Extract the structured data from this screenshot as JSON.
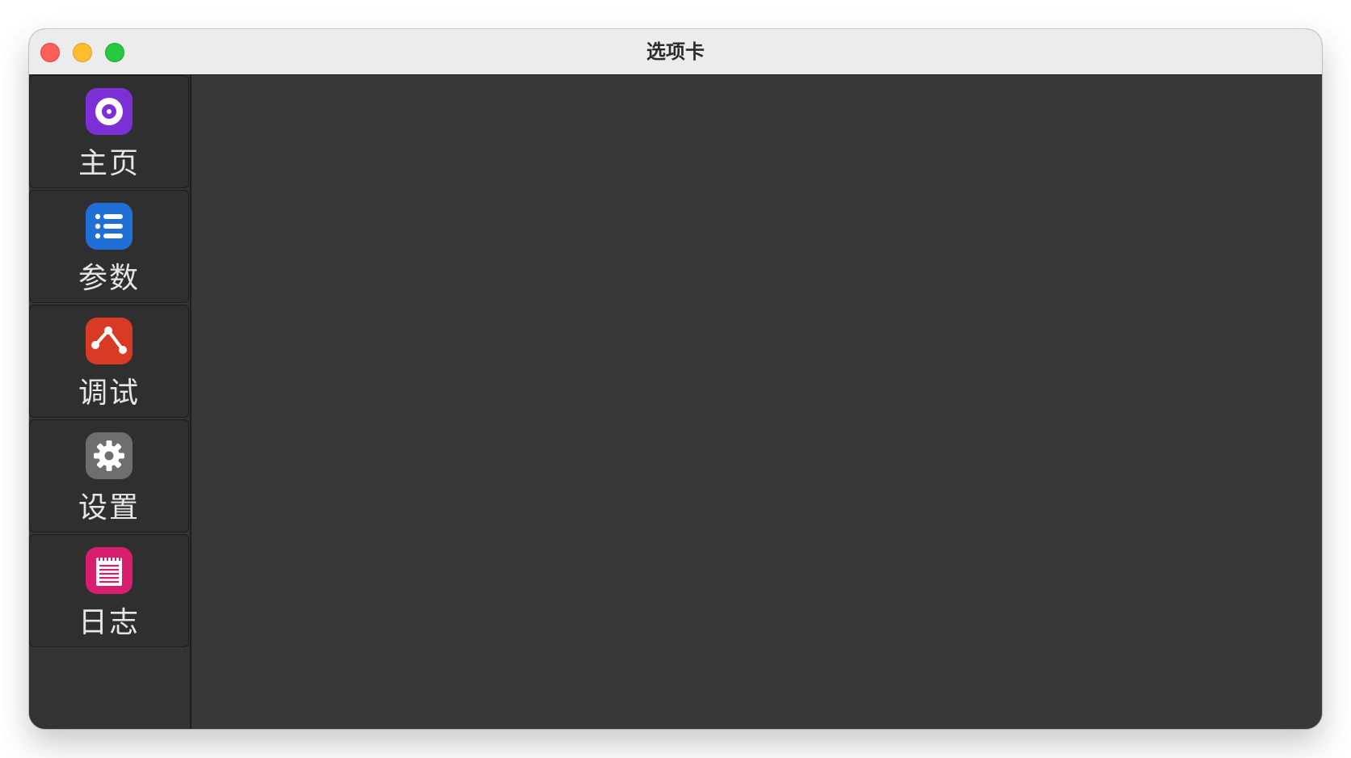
{
  "window": {
    "title": "选项卡"
  },
  "sidebar": {
    "tabs": [
      {
        "label": "主页",
        "icon": "home-disc-icon",
        "color": "#7b2fd4"
      },
      {
        "label": "参数",
        "icon": "list-icon",
        "color": "#1f6fd6"
      },
      {
        "label": "调试",
        "icon": "graph-nodes-icon",
        "color": "#d93a26"
      },
      {
        "label": "设置",
        "icon": "gear-icon",
        "color": "#6e6e6e"
      },
      {
        "label": "日志",
        "icon": "notepad-icon",
        "color": "#d81f6f"
      }
    ]
  },
  "colors": {
    "titlebar": "#ececec",
    "content_background": "#383838",
    "sidebar_background": "#333333",
    "tab_label": "#e6e6e6"
  }
}
